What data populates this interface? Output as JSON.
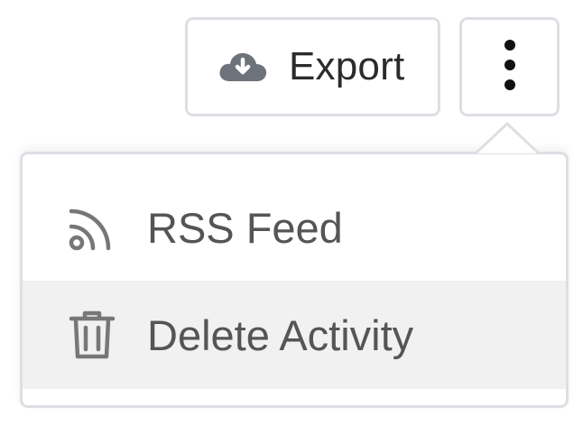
{
  "toolbar": {
    "export_label": "Export",
    "export_icon": "cloud-download-icon",
    "more_icon": "vertical-ellipsis-icon"
  },
  "menu": {
    "items": [
      {
        "label": "RSS Feed",
        "icon": "rss-icon"
      },
      {
        "label": "Delete Activity",
        "icon": "trash-icon"
      }
    ]
  },
  "colors": {
    "border": "#dcdfe3",
    "text_dark": "#2b2b2b",
    "text_menu": "#555555",
    "icon_gray": "#777777",
    "hover_bg": "#f1f1f1"
  }
}
